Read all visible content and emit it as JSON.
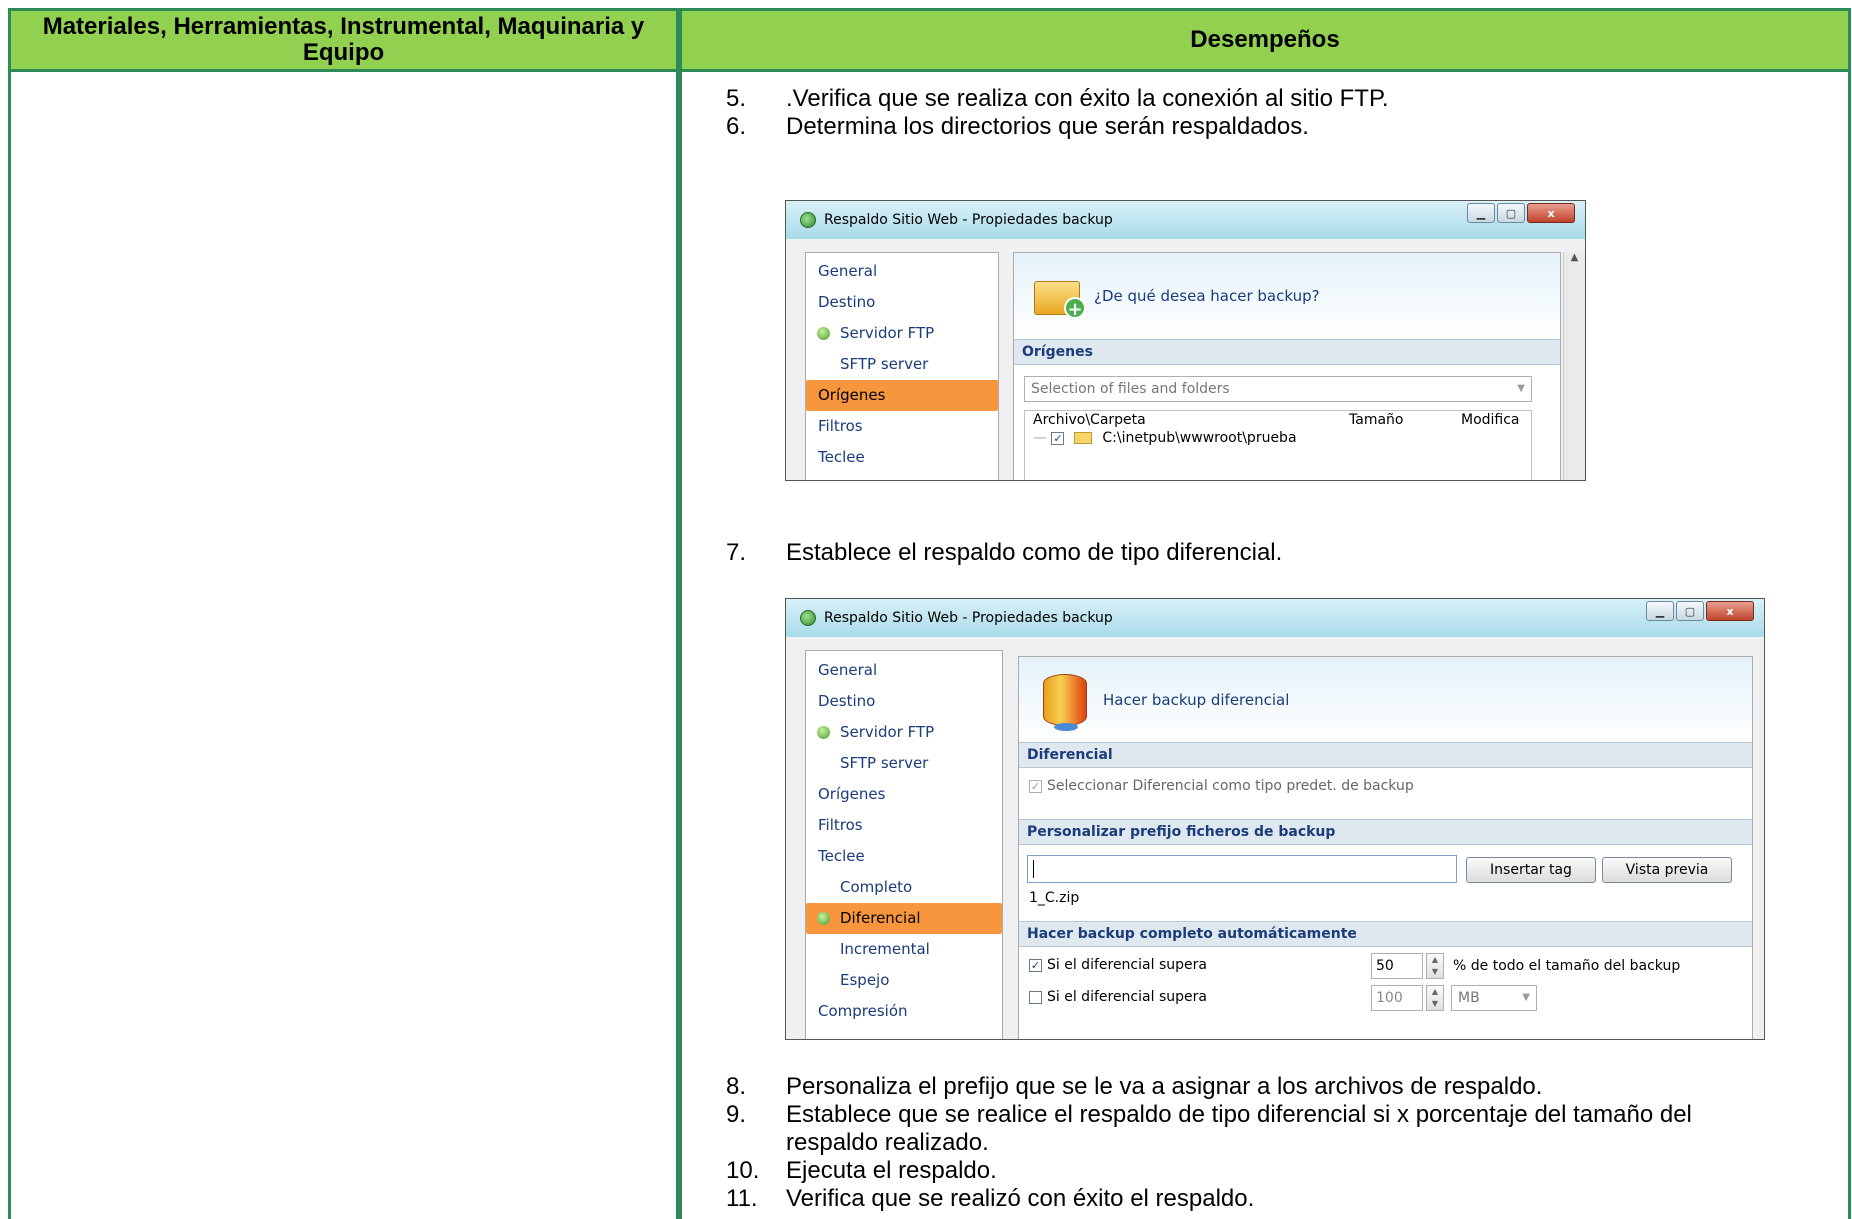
{
  "header": {
    "left": "Materiales, Herramientas, Instrumental, Maquinaria y Equipo",
    "right": "Desempeños"
  },
  "steps_top": [
    {
      "num": "5.",
      "text": ".Verifica que se  realiza con éxito la conexión al sitio FTP."
    },
    {
      "num": "6.",
      "text": "Determina los directorios que serán respaldados."
    }
  ],
  "step7": {
    "num": "7.",
    "text": "Establece el respaldo como de tipo diferencial."
  },
  "steps_bottom": [
    {
      "num": "8.",
      "text": "Personaliza el prefijo que se le va a asignar a los archivos de respaldo."
    },
    {
      "num": "9.",
      "text": "Establece que se realice el respaldo de tipo diferencial si x porcentaje del tamaño del respaldo realizado."
    },
    {
      "num": "10.",
      "text": "Ejecuta el respaldo."
    },
    {
      "num": "11.",
      "text": "Verifica que se realizó con éxito el respaldo."
    }
  ],
  "window1": {
    "title": "Respaldo Sitio Web - Propiedades backup",
    "nav": [
      "General",
      "Destino",
      "Servidor FTP",
      "SFTP server",
      "Orígenes",
      "Filtros",
      "Teclee"
    ],
    "heading": "¿De qué desea hacer backup?",
    "section": "Orígenes",
    "combo": "Selection of files and folders",
    "columns": [
      "Archivo\\Carpeta",
      "Tamaño",
      "Modifica"
    ],
    "row": "C:\\inetpub\\wwwroot\\prueba"
  },
  "window2": {
    "title": "Respaldo Sitio Web - Propiedades backup",
    "nav": [
      "General",
      "Destino",
      "Servidor FTP",
      "SFTP server",
      "Orígenes",
      "Filtros",
      "Teclee",
      "Completo",
      "Diferencial",
      "Incremental",
      "Espejo",
      "Compresión"
    ],
    "heading": "Hacer backup diferencial",
    "section1": "Diferencial",
    "check1": "Seleccionar Diferencial como tipo predet. de backup",
    "section2": "Personalizar prefijo ficheros de backup",
    "prefix_value": "",
    "insert_tag": "Insertar tag",
    "preview": "Vista previa",
    "preview_text": "1_C.zip",
    "section3": "Hacer backup completo automáticamente",
    "row1_label": "Si el diferencial supera",
    "row1_value": "50",
    "row1_suffix": "% de todo el tamaño del backup",
    "row2_label": "Si el diferencial supera",
    "row2_value": "100",
    "row2_unit": "MB"
  },
  "icons": {
    "window_check": "✓",
    "window_close": "x"
  }
}
